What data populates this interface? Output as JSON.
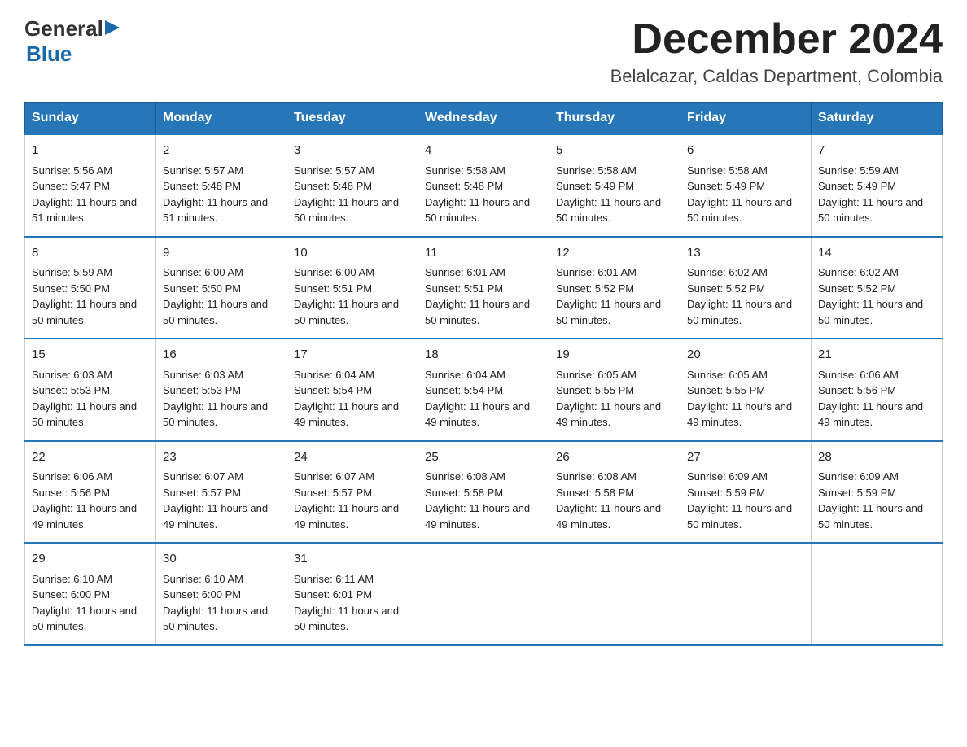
{
  "logo": {
    "general": "General",
    "blue": "Blue",
    "arrow": "▶"
  },
  "title": "December 2024",
  "subtitle": "Belalcazar, Caldas Department, Colombia",
  "days_header": [
    "Sunday",
    "Monday",
    "Tuesday",
    "Wednesday",
    "Thursday",
    "Friday",
    "Saturday"
  ],
  "weeks": [
    [
      {
        "num": "1",
        "sunrise": "5:56 AM",
        "sunset": "5:47 PM",
        "daylight": "11 hours and 51 minutes."
      },
      {
        "num": "2",
        "sunrise": "5:57 AM",
        "sunset": "5:48 PM",
        "daylight": "11 hours and 51 minutes."
      },
      {
        "num": "3",
        "sunrise": "5:57 AM",
        "sunset": "5:48 PM",
        "daylight": "11 hours and 50 minutes."
      },
      {
        "num": "4",
        "sunrise": "5:58 AM",
        "sunset": "5:48 PM",
        "daylight": "11 hours and 50 minutes."
      },
      {
        "num": "5",
        "sunrise": "5:58 AM",
        "sunset": "5:49 PM",
        "daylight": "11 hours and 50 minutes."
      },
      {
        "num": "6",
        "sunrise": "5:58 AM",
        "sunset": "5:49 PM",
        "daylight": "11 hours and 50 minutes."
      },
      {
        "num": "7",
        "sunrise": "5:59 AM",
        "sunset": "5:49 PM",
        "daylight": "11 hours and 50 minutes."
      }
    ],
    [
      {
        "num": "8",
        "sunrise": "5:59 AM",
        "sunset": "5:50 PM",
        "daylight": "11 hours and 50 minutes."
      },
      {
        "num": "9",
        "sunrise": "6:00 AM",
        "sunset": "5:50 PM",
        "daylight": "11 hours and 50 minutes."
      },
      {
        "num": "10",
        "sunrise": "6:00 AM",
        "sunset": "5:51 PM",
        "daylight": "11 hours and 50 minutes."
      },
      {
        "num": "11",
        "sunrise": "6:01 AM",
        "sunset": "5:51 PM",
        "daylight": "11 hours and 50 minutes."
      },
      {
        "num": "12",
        "sunrise": "6:01 AM",
        "sunset": "5:52 PM",
        "daylight": "11 hours and 50 minutes."
      },
      {
        "num": "13",
        "sunrise": "6:02 AM",
        "sunset": "5:52 PM",
        "daylight": "11 hours and 50 minutes."
      },
      {
        "num": "14",
        "sunrise": "6:02 AM",
        "sunset": "5:52 PM",
        "daylight": "11 hours and 50 minutes."
      }
    ],
    [
      {
        "num": "15",
        "sunrise": "6:03 AM",
        "sunset": "5:53 PM",
        "daylight": "11 hours and 50 minutes."
      },
      {
        "num": "16",
        "sunrise": "6:03 AM",
        "sunset": "5:53 PM",
        "daylight": "11 hours and 50 minutes."
      },
      {
        "num": "17",
        "sunrise": "6:04 AM",
        "sunset": "5:54 PM",
        "daylight": "11 hours and 49 minutes."
      },
      {
        "num": "18",
        "sunrise": "6:04 AM",
        "sunset": "5:54 PM",
        "daylight": "11 hours and 49 minutes."
      },
      {
        "num": "19",
        "sunrise": "6:05 AM",
        "sunset": "5:55 PM",
        "daylight": "11 hours and 49 minutes."
      },
      {
        "num": "20",
        "sunrise": "6:05 AM",
        "sunset": "5:55 PM",
        "daylight": "11 hours and 49 minutes."
      },
      {
        "num": "21",
        "sunrise": "6:06 AM",
        "sunset": "5:56 PM",
        "daylight": "11 hours and 49 minutes."
      }
    ],
    [
      {
        "num": "22",
        "sunrise": "6:06 AM",
        "sunset": "5:56 PM",
        "daylight": "11 hours and 49 minutes."
      },
      {
        "num": "23",
        "sunrise": "6:07 AM",
        "sunset": "5:57 PM",
        "daylight": "11 hours and 49 minutes."
      },
      {
        "num": "24",
        "sunrise": "6:07 AM",
        "sunset": "5:57 PM",
        "daylight": "11 hours and 49 minutes."
      },
      {
        "num": "25",
        "sunrise": "6:08 AM",
        "sunset": "5:58 PM",
        "daylight": "11 hours and 49 minutes."
      },
      {
        "num": "26",
        "sunrise": "6:08 AM",
        "sunset": "5:58 PM",
        "daylight": "11 hours and 49 minutes."
      },
      {
        "num": "27",
        "sunrise": "6:09 AM",
        "sunset": "5:59 PM",
        "daylight": "11 hours and 50 minutes."
      },
      {
        "num": "28",
        "sunrise": "6:09 AM",
        "sunset": "5:59 PM",
        "daylight": "11 hours and 50 minutes."
      }
    ],
    [
      {
        "num": "29",
        "sunrise": "6:10 AM",
        "sunset": "6:00 PM",
        "daylight": "11 hours and 50 minutes."
      },
      {
        "num": "30",
        "sunrise": "6:10 AM",
        "sunset": "6:00 PM",
        "daylight": "11 hours and 50 minutes."
      },
      {
        "num": "31",
        "sunrise": "6:11 AM",
        "sunset": "6:01 PM",
        "daylight": "11 hours and 50 minutes."
      },
      null,
      null,
      null,
      null
    ]
  ],
  "labels": {
    "sunrise": "Sunrise:",
    "sunset": "Sunset:",
    "daylight": "Daylight:"
  }
}
